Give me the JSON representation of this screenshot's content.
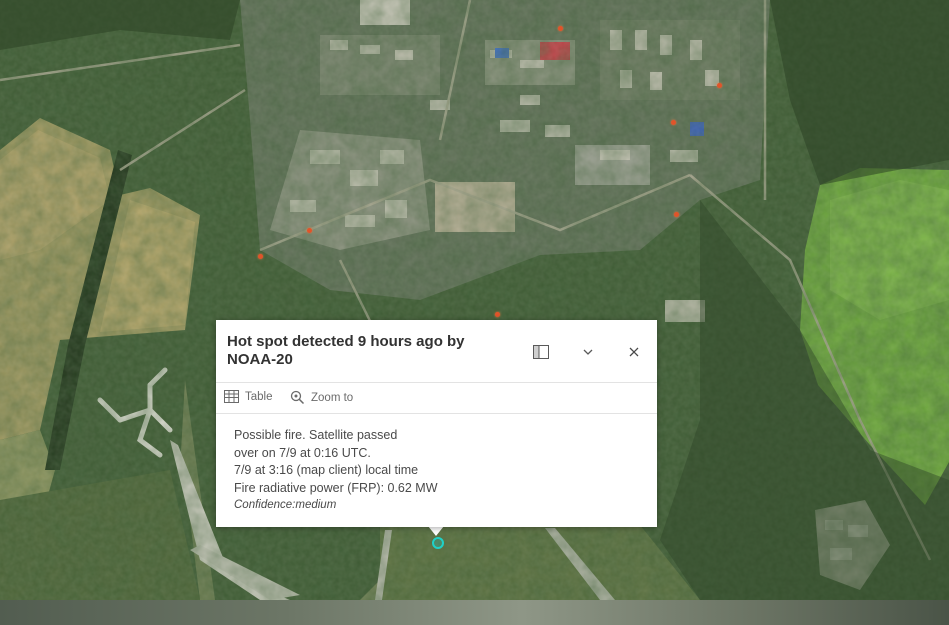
{
  "popup": {
    "title": "Hot spot detected 9 hours ago by NOAA-20",
    "actions": {
      "table_label": "Table",
      "zoom_label": "Zoom to"
    },
    "lines": [
      "Possible fire. Satellite passed",
      "over on 7/9 at 0:16 UTC.",
      "7/9 at 3:16 (map client) local time",
      "Fire radiative power (FRP): 0.62 MW"
    ],
    "confidence": "Confidence:medium",
    "icons": {
      "dock": "dock-icon",
      "collapse": "chevron-down-icon",
      "close": "close-icon",
      "table": "table-icon",
      "zoom": "zoom-to-icon"
    }
  },
  "map": {
    "basemap": "satellite imagery",
    "hotspot_color": "#e0542a",
    "selected_marker_color": "#1fd1c8"
  }
}
